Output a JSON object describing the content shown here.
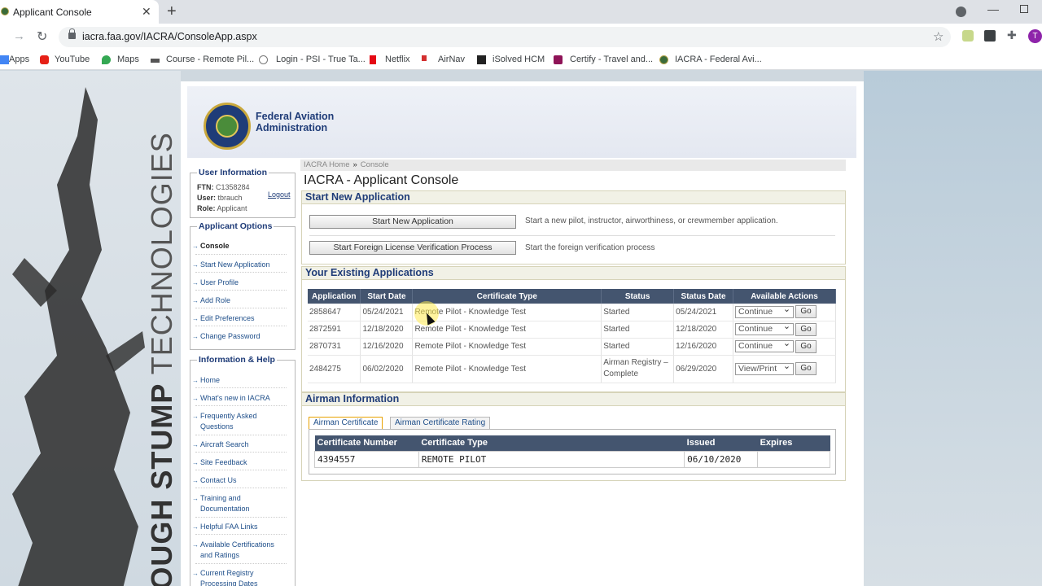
{
  "browser": {
    "tab_title": "Applicant Console",
    "url": "iacra.faa.gov/IACRA/ConsoleApp.aspx",
    "avatar_letter": "T",
    "bookmarks": [
      "Apps",
      "YouTube",
      "Maps",
      "Course - Remote Pil...",
      "Login - PSI - True Ta...",
      "Netflix",
      "AirNav",
      "iSolved HCM",
      "Certify - Travel and...",
      "IACRA - Federal Avi..."
    ]
  },
  "background": {
    "brand_bold": "TOUGH STUMP",
    "brand_rest": "TECHNOLOGIES"
  },
  "header": {
    "agency_line1": "Federal Aviation",
    "agency_line2": "Administration"
  },
  "sidebar": {
    "user_info": {
      "legend": "User Information",
      "ftn_label": "FTN:",
      "ftn_value": "C1358284",
      "user_label": "User:",
      "user_value": "tbrauch",
      "role_label": "Role:",
      "role_value": "Applicant",
      "logout": "Logout"
    },
    "applicant_options": {
      "legend": "Applicant Options",
      "items": [
        "Console",
        "Start New Application",
        "User Profile",
        "Add Role",
        "Edit Preferences",
        "Change Password"
      ]
    },
    "info_help": {
      "legend": "Information & Help",
      "items": [
        "Home",
        "What's new in IACRA",
        "Frequently Asked",
        "Questions",
        "Aircraft Search",
        "Site Feedback",
        "Contact Us",
        "Training and",
        "Documentation",
        "Helpful FAA Links",
        "Available Certifications",
        "and Ratings",
        "Current Registry",
        "Processing Dates"
      ]
    }
  },
  "breadcrumb": {
    "home": "IACRA Home",
    "sep": "»",
    "current": "Console"
  },
  "title": "IACRA - Applicant Console",
  "start_new": {
    "heading": "Start New Application",
    "btn1": "Start New Application",
    "desc1": "Start a new pilot, instructor, airworthiness, or crewmember application.",
    "btn2": "Start Foreign License Verification Process",
    "desc2": "Start the foreign verification process"
  },
  "existing": {
    "heading": "Your Existing Applications",
    "columns": [
      "Application",
      "Start Date",
      "Certificate Type",
      "Status",
      "Status Date",
      "Available Actions"
    ],
    "rows": [
      {
        "app": "2858647",
        "start": "05/24/2021",
        "cert": "Remote Pilot - Knowledge Test",
        "status": "Started",
        "date": "05/24/2021",
        "action": "Continue",
        "go": "Go"
      },
      {
        "app": "2872591",
        "start": "12/18/2020",
        "cert": "Remote Pilot - Knowledge Test",
        "status": "Started",
        "date": "12/18/2020",
        "action": "Continue",
        "go": "Go"
      },
      {
        "app": "2870731",
        "start": "12/16/2020",
        "cert": "Remote Pilot - Knowledge Test",
        "status": "Started",
        "date": "12/16/2020",
        "action": "Continue",
        "go": "Go"
      },
      {
        "app": "2484275",
        "start": "06/02/2020",
        "cert": "Remote Pilot - Knowledge Test",
        "status": "Airman Registry – Complete",
        "date": "06/29/2020",
        "action": "View/Print",
        "go": "Go"
      }
    ]
  },
  "airman": {
    "heading": "Airman Information",
    "tabs": [
      "Airman Certificate",
      "Airman Certificate Rating"
    ],
    "columns": [
      "Certificate Number",
      "Certificate Type",
      "Issued",
      "Expires"
    ],
    "row": {
      "number": "4394557",
      "type": "REMOTE PILOT",
      "issued": "06/10/2020",
      "expires": ""
    }
  }
}
